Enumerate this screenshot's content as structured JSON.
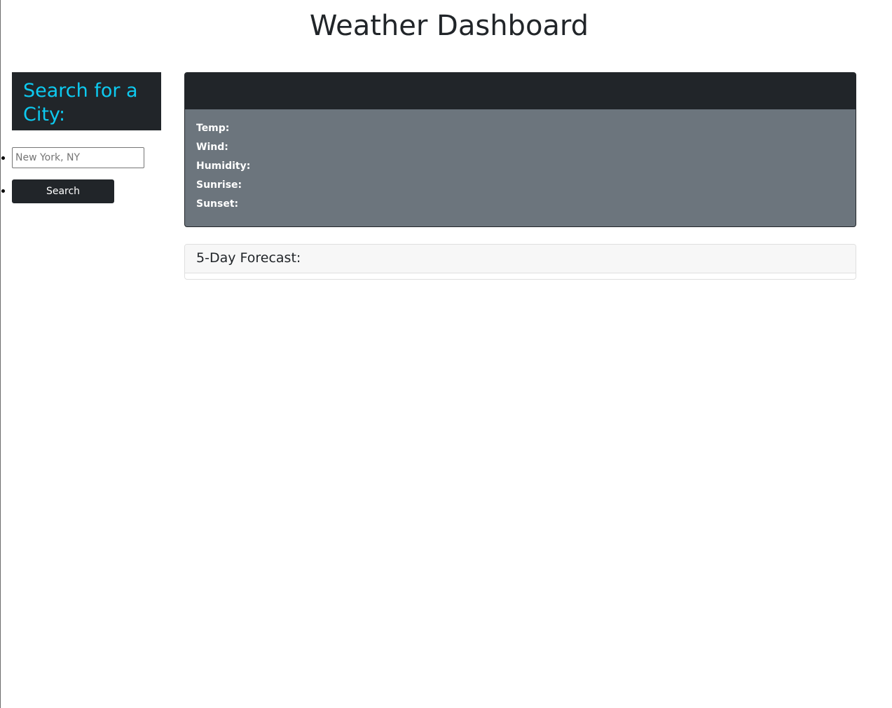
{
  "header": {
    "title": "Weather Dashboard"
  },
  "sidebar": {
    "heading": "Search for a City:",
    "input": {
      "placeholder": "New York, NY",
      "value": ""
    },
    "search_label": "Search"
  },
  "current_weather": {
    "stats": [
      {
        "label": "Temp:"
      },
      {
        "label": "Wind:"
      },
      {
        "label": "Humidity:"
      },
      {
        "label": "Sunrise:"
      },
      {
        "label": "Sunset:"
      }
    ]
  },
  "forecast": {
    "heading": "5-Day Forecast:"
  },
  "colors": {
    "dark": "#212529",
    "accent": "#0dcaf0",
    "card_body": "#6c757d"
  }
}
